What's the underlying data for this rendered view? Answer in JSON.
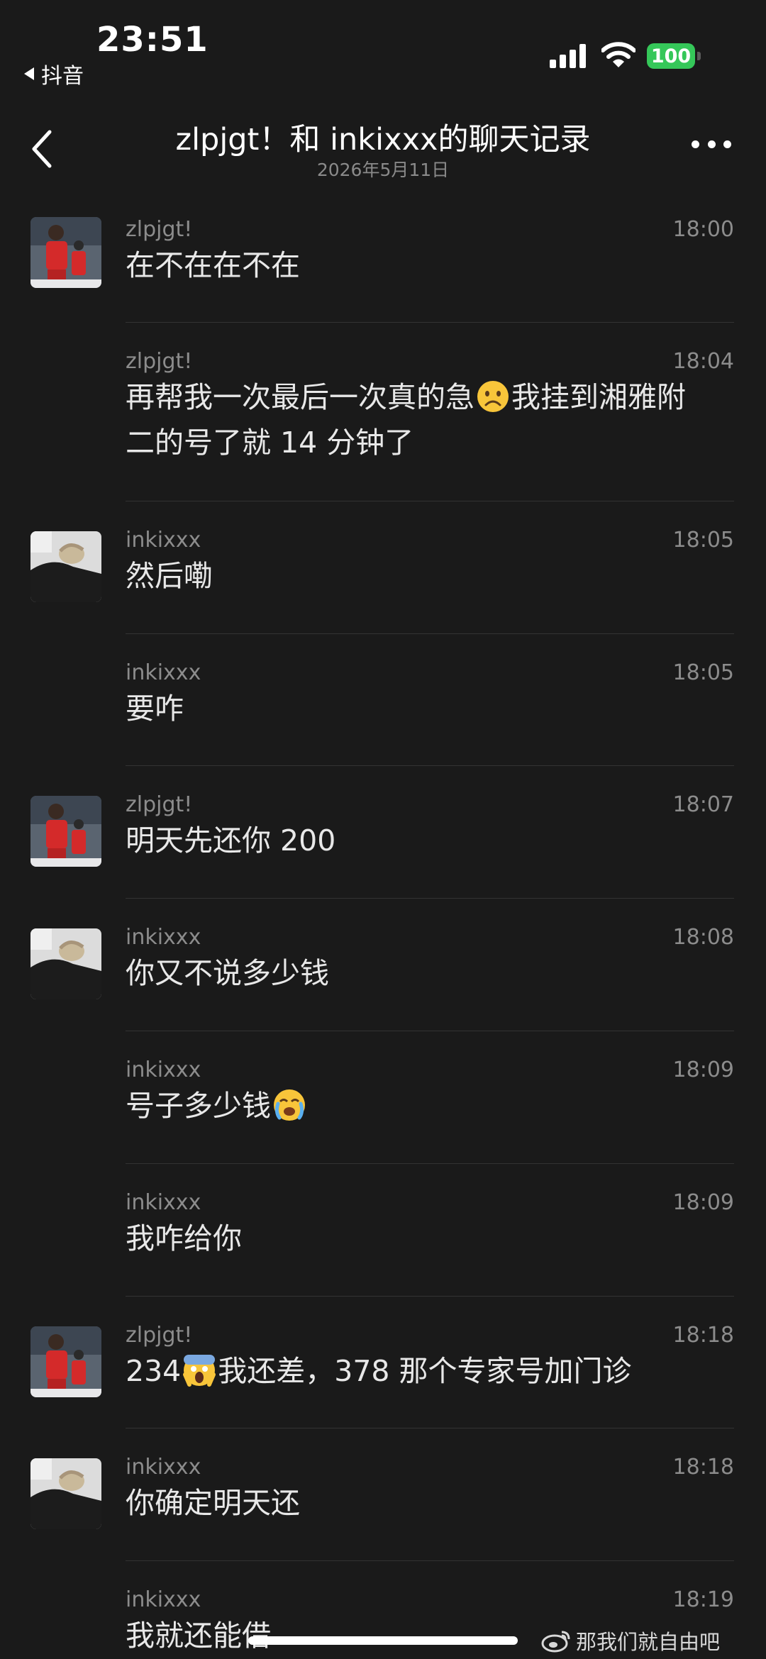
{
  "status_bar": {
    "time": "23:51",
    "back_app": "抖音",
    "battery": "100"
  },
  "header": {
    "title": "zlpjgt！和 inkixxx的聊天记录",
    "subtitle": "2026年5月11日"
  },
  "messages": [
    {
      "sender": "zlpjgt!",
      "time": "18:00",
      "text": "在不在在不在",
      "avatar": "football-player-avatar"
    },
    {
      "sender": "zlpjgt!",
      "time": "18:04",
      "text_before": "再帮我一次最后一次真的急",
      "emoji": "frowning-face-emoji",
      "text_after": "我挂到湘雅附二的号了就 14 分钟了"
    },
    {
      "sender": "inkixxx",
      "time": "18:05",
      "text": "然后嘞",
      "avatar": "person-lying-avatar"
    },
    {
      "sender": "inkixxx",
      "time": "18:05",
      "text": "要咋"
    },
    {
      "sender": "zlpjgt!",
      "time": "18:07",
      "text": "明天先还你 200",
      "avatar": "football-player-avatar"
    },
    {
      "sender": "inkixxx",
      "time": "18:08",
      "text": "你又不说多少钱",
      "avatar": "person-lying-avatar"
    },
    {
      "sender": "inkixxx",
      "time": "18:09",
      "text_before": "号子多少钱",
      "emoji": "crying-face-emoji",
      "text_after": ""
    },
    {
      "sender": "inkixxx",
      "time": "18:09",
      "text": "我咋给你"
    },
    {
      "sender": "zlpjgt!",
      "time": "18:18",
      "text_before": "234",
      "emoji": "screaming-face-emoji",
      "text_after": "我还差，378 那个专家号加门诊",
      "avatar": "football-player-avatar"
    },
    {
      "sender": "inkixxx",
      "time": "18:18",
      "text": "你确定明天还",
      "avatar": "person-lying-avatar"
    },
    {
      "sender": "inkixxx",
      "time": "18:19",
      "text": "我就还能借"
    }
  ],
  "watermark": "那我们就自由吧",
  "colors": {
    "background": "#1a1a1a",
    "battery": "#35c759",
    "secondary_text": "#8c8c8c"
  }
}
